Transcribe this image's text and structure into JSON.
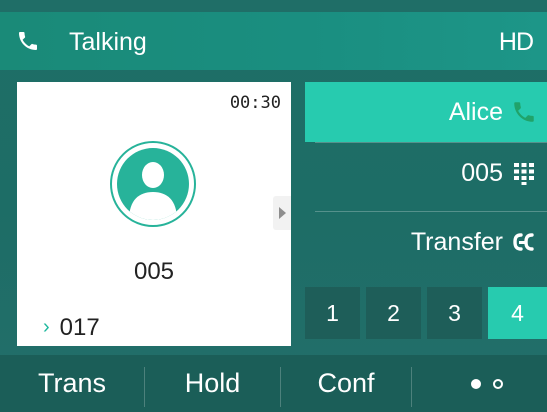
{
  "title_bar": {
    "status": "Talking",
    "quality_badge": "HD",
    "status_icon": "phone-icon"
  },
  "call_card": {
    "duration": "00:30",
    "avatar_icon": "contact-avatar-icon",
    "number": "005",
    "line_indicator": "›",
    "line": "017"
  },
  "right_panel": {
    "contact": {
      "label": "Alice",
      "icon": "phone-icon"
    },
    "number_row": {
      "label": "005",
      "icon": "dialpad-icon"
    },
    "transfer_row": {
      "label": "Transfer",
      "icon": "transfer-icon"
    }
  },
  "line_keys": [
    {
      "label": "1",
      "active": false
    },
    {
      "label": "2",
      "active": false
    },
    {
      "label": "3",
      "active": false
    },
    {
      "label": "4",
      "active": true
    }
  ],
  "softkeys": {
    "trans": "Trans",
    "hold": "Hold",
    "conf": "Conf",
    "more_icon": "more-dots-icon"
  },
  "colors": {
    "accent": "#27cbaf",
    "header": "#1a8e80",
    "background": "#1f6e67",
    "softkey_bar": "#1b5e58"
  }
}
